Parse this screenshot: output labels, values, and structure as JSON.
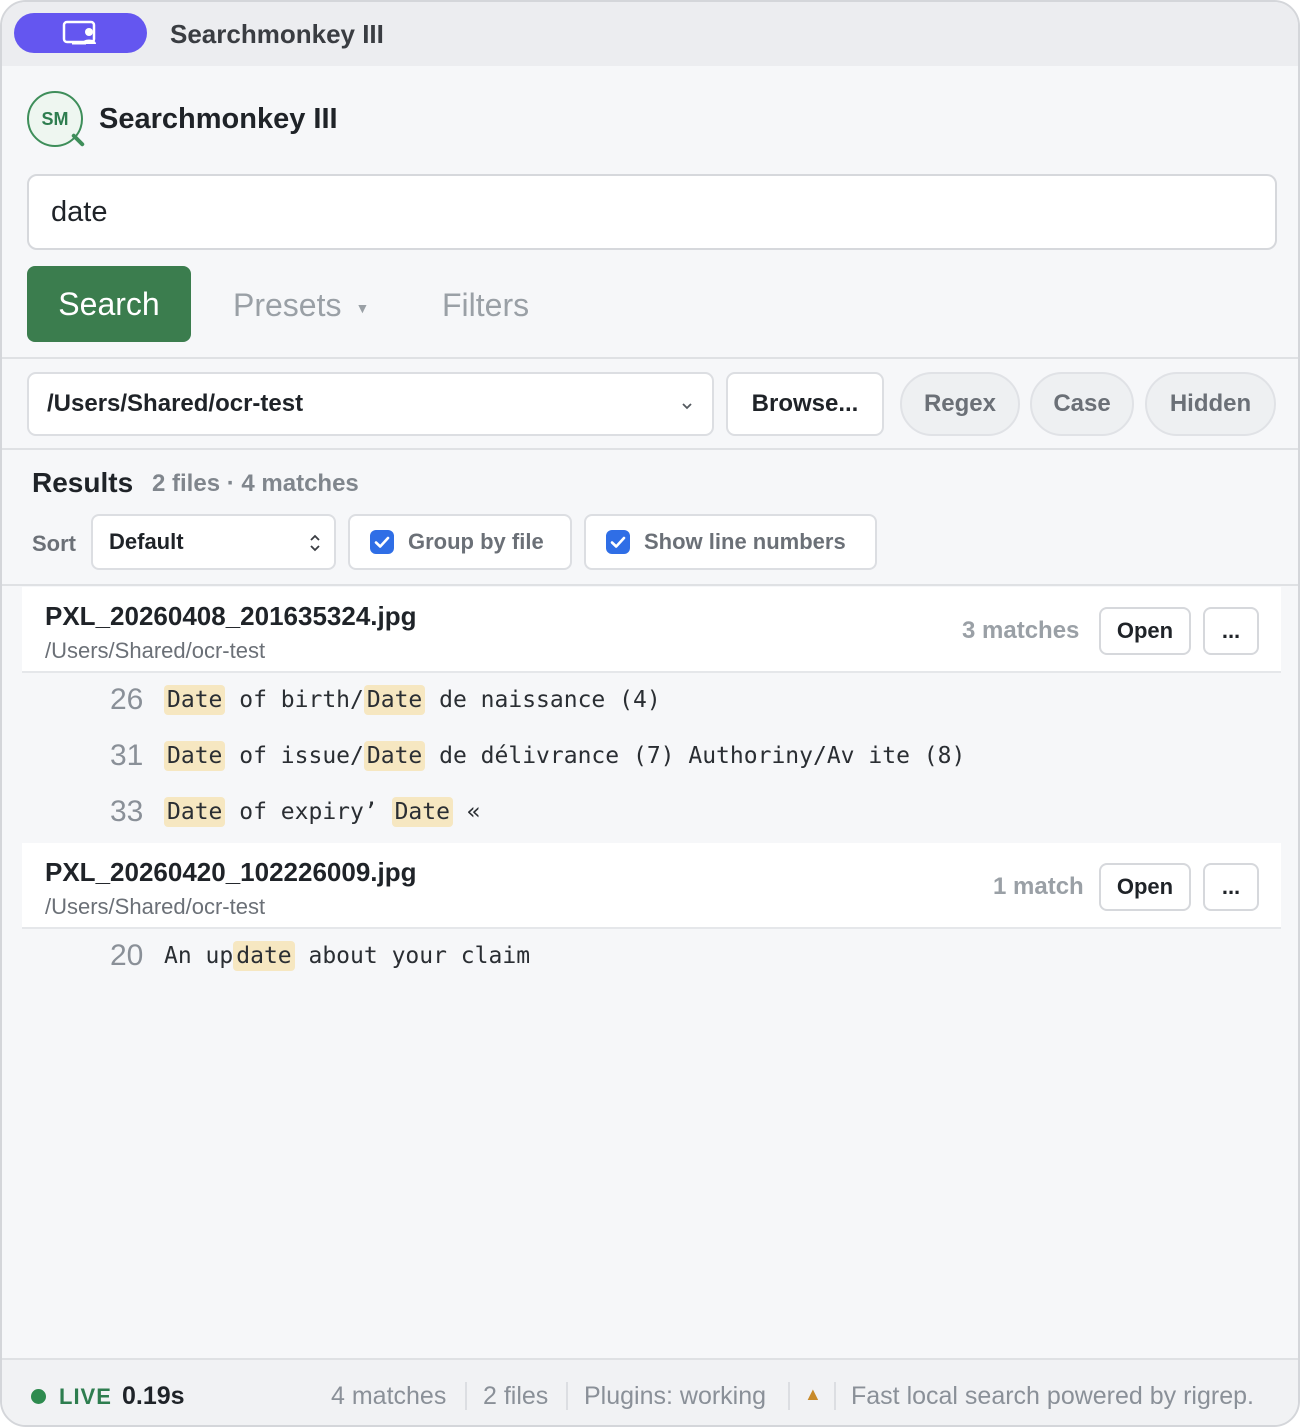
{
  "window": {
    "title": "Searchmonkey III"
  },
  "app": {
    "logo_text": "SM",
    "title": "Searchmonkey III"
  },
  "search": {
    "value": "date",
    "button_label": "Search"
  },
  "nav": {
    "presets_label": "Presets",
    "filters_label": "Filters"
  },
  "path": {
    "value": "/Users/Shared/ocr-test",
    "browse_label": "Browse..."
  },
  "toggles": {
    "regex": "Regex",
    "case": "Case",
    "hidden": "Hidden"
  },
  "results": {
    "title": "Results",
    "summary": "2 files · 4 matches",
    "sort_label": "Sort",
    "sort_value": "Default",
    "group_by_file": {
      "label": "Group by file",
      "checked": true
    },
    "show_line_numbers": {
      "label": "Show line numbers",
      "checked": true
    }
  },
  "files": [
    {
      "name": "PXL_20260408_201635324.jpg",
      "path": "/Users/Shared/ocr-test",
      "match_count": "3 matches",
      "open_label": "Open",
      "more_label": "...",
      "lines": [
        {
          "number": "26",
          "segments": [
            {
              "text": "Date",
              "hl": true
            },
            {
              "text": " of birth/",
              "hl": false
            },
            {
              "text": "Date",
              "hl": true
            },
            {
              "text": " de naissance (4)",
              "hl": false
            }
          ]
        },
        {
          "number": "31",
          "segments": [
            {
              "text": "Date",
              "hl": true
            },
            {
              "text": " of issue/",
              "hl": false
            },
            {
              "text": "Date",
              "hl": true
            },
            {
              "text": " de délivrance (7) Authoriny/Av ite (8)",
              "hl": false
            }
          ]
        },
        {
          "number": "33",
          "segments": [
            {
              "text": "Date",
              "hl": true
            },
            {
              "text": " of expiry’ ",
              "hl": false
            },
            {
              "text": "Date",
              "hl": true
            },
            {
              "text": " «",
              "hl": false
            }
          ]
        }
      ]
    },
    {
      "name": "PXL_20260420_102226009.jpg",
      "path": "/Users/Shared/ocr-test",
      "match_count": "1 match",
      "open_label": "Open",
      "more_label": "...",
      "lines": [
        {
          "number": "20",
          "segments": [
            {
              "text": "An up",
              "hl": false
            },
            {
              "text": "date",
              "hl": true
            },
            {
              "text": " about your claim",
              "hl": false
            }
          ]
        }
      ]
    }
  ],
  "status": {
    "live_label": "LIVE",
    "time": "0.19s",
    "matches": "4 matches",
    "files": "2 files",
    "plugins": "Plugins: working",
    "warning_icon": "warning-icon",
    "tagline": "Fast local search powered by rigrep."
  },
  "colors": {
    "accent_green": "#3b7d4e",
    "title_pill": "#6456f0",
    "highlight": "#f6e7c1",
    "checkbox_blue": "#2f6ee6"
  }
}
